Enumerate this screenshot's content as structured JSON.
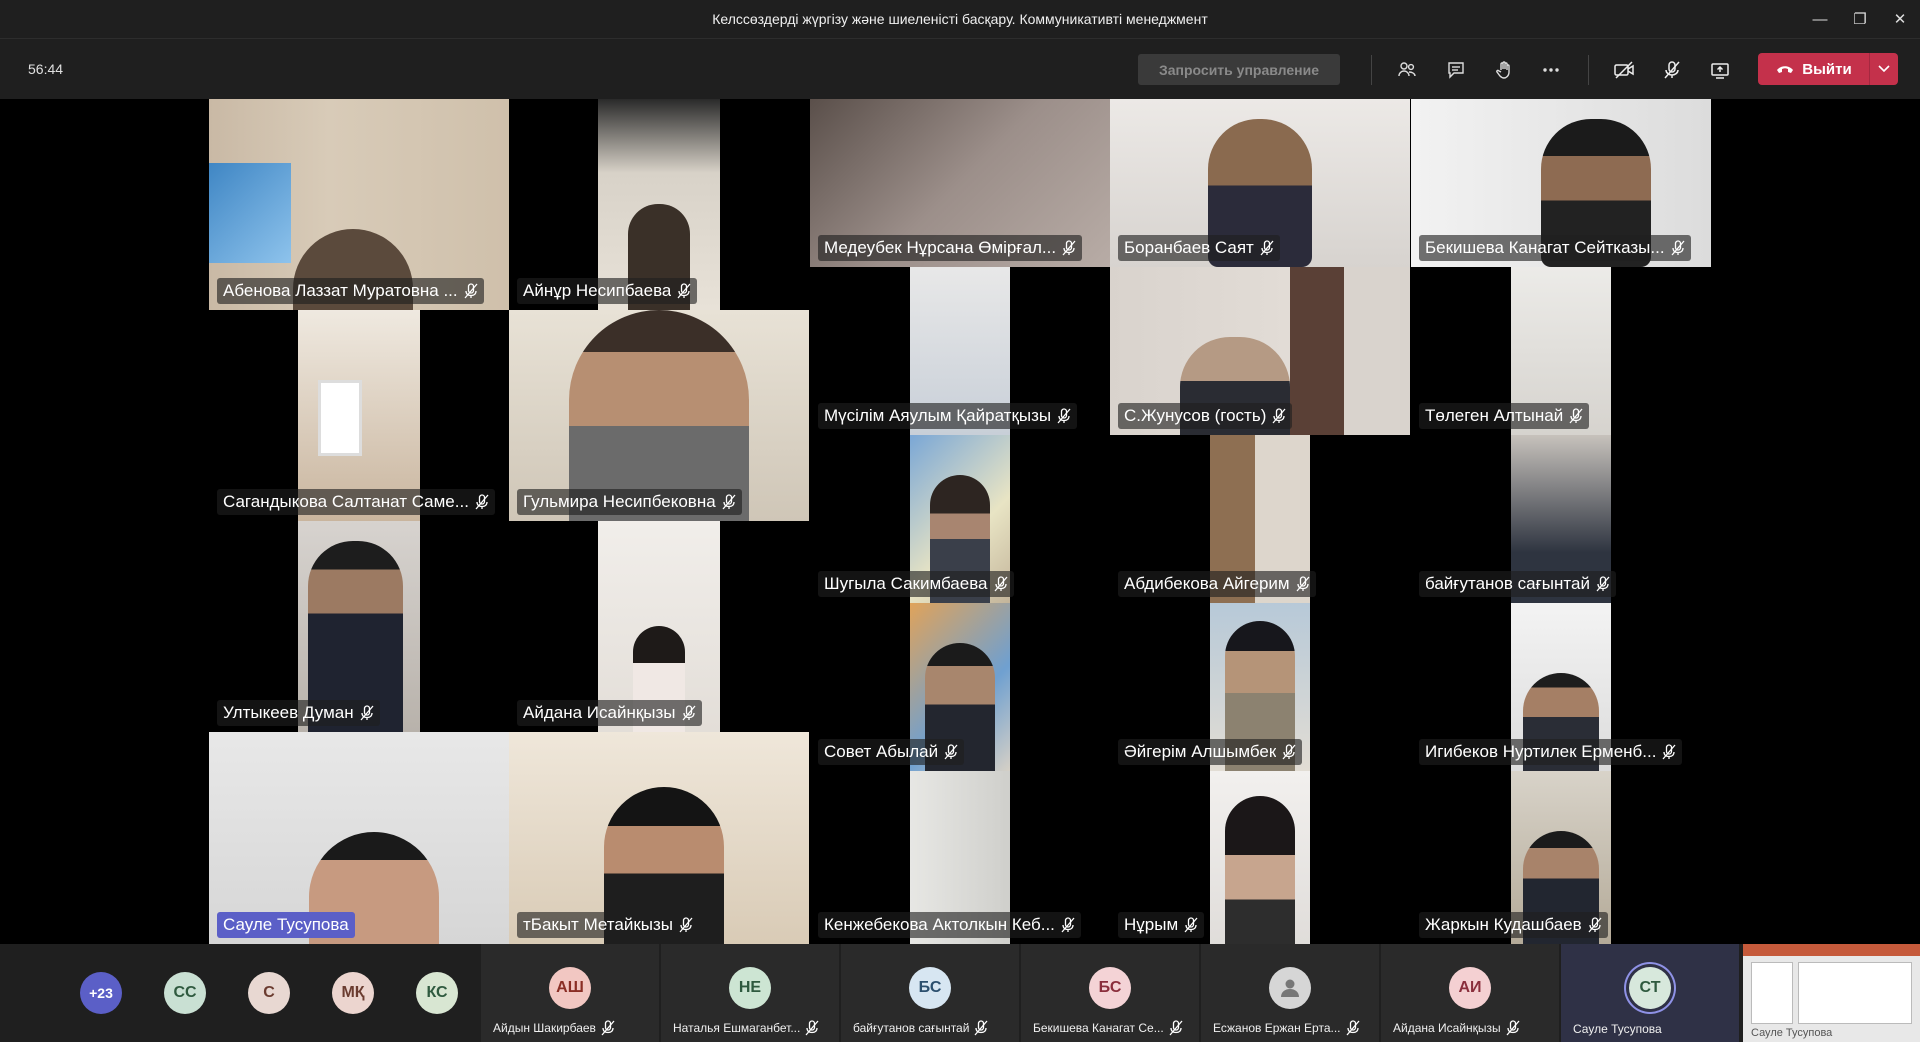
{
  "window": {
    "title": "Келссөздерді жүргізу және шиеленісті басқару. Коммуникативті менеджмент"
  },
  "toolbar": {
    "timer": "56:44",
    "request_control_label": "Запросить управление",
    "leave_label": "Выйти",
    "colors": {
      "leave": "#c4314b",
      "accent": "#5b5fc7"
    }
  },
  "participants": [
    {
      "name": "Абенова Лаззат Муратовна ..."
    },
    {
      "name": "Айнұр Несипбаева"
    },
    {
      "name": "Медеубек Нұрсана Өмірғал..."
    },
    {
      "name": "Боранбаев Саят"
    },
    {
      "name": "Бекишева Канагат Сейтказы..."
    },
    {
      "name": "Сагандыкова Салтанат Саме..."
    },
    {
      "name": "Гульмира Несипбековна"
    },
    {
      "name": "Мүсілім Аяулым Қайратқызы"
    },
    {
      "name": "С.Жунусов (гость)"
    },
    {
      "name": "Төлеген Алтынай"
    },
    {
      "name": "Шугыла Сакимбаева"
    },
    {
      "name": "Абдибекова Айгерим"
    },
    {
      "name": "байғутанов сағынтай"
    },
    {
      "name": "Ултыкеев Думан"
    },
    {
      "name": "Айдана Исайнқызы"
    },
    {
      "name": "Совет Абылай"
    },
    {
      "name": "Әйгерім Алшымбек"
    },
    {
      "name": "Игибеков Нуртилек Ерменб..."
    },
    {
      "name": "Сауле Тусупова"
    },
    {
      "name": "тБакыт Метайкызы"
    },
    {
      "name": "Кенжебекова Актолкын Кеб..."
    },
    {
      "name": "Нұрым"
    },
    {
      "name": "Жаркын Кудашбаев"
    }
  ],
  "tray": {
    "overflow": "+23",
    "small_avatars": [
      {
        "initials": "СС",
        "color": "#c9e0d3"
      },
      {
        "initials": "С",
        "color": "#e8d8d2"
      },
      {
        "initials": "МҚ",
        "color": "#ecd5cf"
      },
      {
        "initials": "КС",
        "color": "#d8e6d2"
      }
    ],
    "tiles": [
      {
        "initials": "АШ",
        "name": "Айдын Шакирбаев",
        "color": "#f2c7c2"
      },
      {
        "initials": "НЕ",
        "name": "Наталья Ешмаганбет...",
        "color": "#cde5d3"
      },
      {
        "initials": "БС",
        "name": "байғутанов сағынтай",
        "color": "#d7e6f2"
      },
      {
        "initials": "БС",
        "name": "Бекишева Канагат Се...",
        "color": "#f4d3d6"
      },
      {
        "initials": "",
        "name": "Есжанов Ержан Ерта...",
        "color": "#d6d6d6"
      },
      {
        "initials": "АИ",
        "name": "Айдана Исайнқызы",
        "color": "#f4d0d2"
      },
      {
        "initials": "СТ",
        "name": "Сауле Тусупова",
        "color": "#d7e8dc"
      }
    ],
    "share_preview_label": "Сауле Тусупова"
  }
}
